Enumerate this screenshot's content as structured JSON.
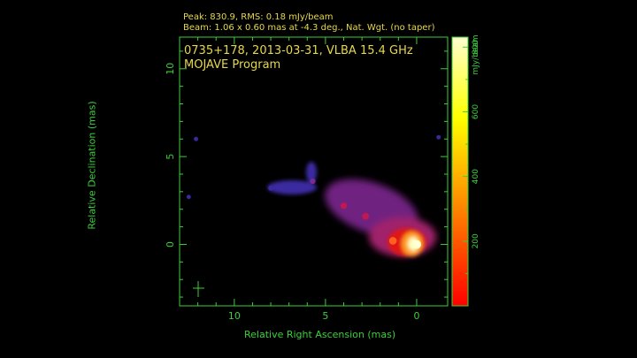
{
  "header": {
    "line1": "Peak: 830.9, RMS: 0.18 mJy/beam",
    "line2": "Beam: 1.06 x 0.60 mas at -4.3 deg., Nat. Wgt. (no taper)"
  },
  "plot_text": {
    "title": "0735+178, 2013-03-31, VLBA 15.4 GHz",
    "subtitle": "MOJAVE Program"
  },
  "chart_data": {
    "type": "heatmap",
    "title": "0735+178, 2013-03-31, VLBA 15.4 GHz",
    "subtitle": "MOJAVE Program",
    "xlabel": "Relative Right Ascension (mas)",
    "ylabel": "Relative Declination (mas)",
    "x_reversed": true,
    "xlim": [
      13,
      -1.7
    ],
    "ylim": [
      -3.5,
      11.8
    ],
    "x_ticks": [
      10,
      5,
      0
    ],
    "y_ticks": [
      0,
      5,
      10
    ],
    "colorbar": {
      "label": "mJy/beam",
      "ticks": [
        200,
        400,
        600,
        800
      ],
      "range": [
        0,
        830.9
      ],
      "colors": [
        "#ff0000",
        "#ff8000",
        "#ffff00",
        "#ffffd0"
      ]
    },
    "peak": 830.9,
    "rms": 0.18,
    "unit": "mJy/beam",
    "beam": {
      "major_mas": 1.06,
      "minor_mas": 0.6,
      "pa_deg": -4.3
    },
    "components": [
      {
        "x": 0.0,
        "y": 0.0,
        "flux": 830.9
      },
      {
        "x": 1.3,
        "y": 0.2,
        "flux": 220
      },
      {
        "x": 2.8,
        "y": 1.6,
        "flux": 110
      },
      {
        "x": 4.0,
        "y": 2.2,
        "flux": 60
      },
      {
        "x": 5.7,
        "y": 3.6,
        "flux": 25
      },
      {
        "x": 8.0,
        "y": 3.2,
        "flux": 12
      },
      {
        "x": 12.5,
        "y": 2.7,
        "flux": 6
      },
      {
        "x": 12.1,
        "y": 6.0,
        "flux": 6
      },
      {
        "x": -1.2,
        "y": 6.1,
        "flux": 6
      }
    ],
    "colors": {
      "axes": "#3ccf3c",
      "text": "#e6d84a",
      "background": "#000000"
    }
  }
}
